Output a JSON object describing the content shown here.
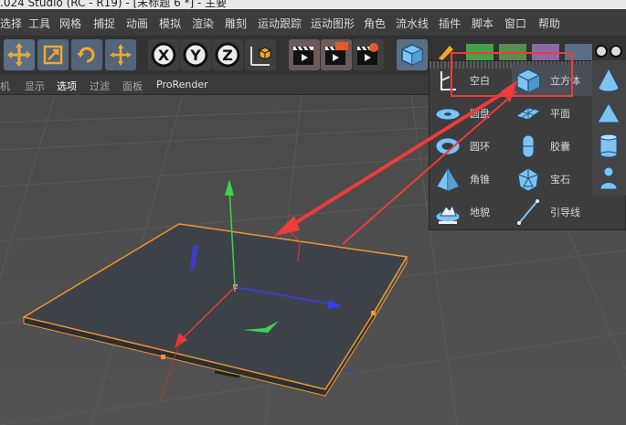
{
  "window": {
    "title": ".024 Studio (RC - R19) - [未标题 6 *] - 主要"
  },
  "menu": [
    "选择",
    "工具",
    "网格",
    "捕捉",
    "动画",
    "模拟",
    "渲染",
    "雕刻",
    "运动跟踪",
    "运动图形",
    "角色",
    "流水线",
    "插件",
    "脚本",
    "窗口",
    "帮助"
  ],
  "viewport_menu": [
    "机",
    "显示",
    "选项",
    "过滤",
    "面板",
    "ProRender"
  ],
  "dropdown": {
    "items": [
      {
        "label": "空白",
        "icon": "null-object-icon"
      },
      {
        "label": "立方体",
        "icon": "cube-icon"
      },
      {
        "label": "圆盘",
        "icon": "disc-icon"
      },
      {
        "label": "平面",
        "icon": "plane-icon"
      },
      {
        "label": "圆环",
        "icon": "torus-icon"
      },
      {
        "label": "胶囊",
        "icon": "capsule-icon"
      },
      {
        "label": "角锥",
        "icon": "pyramid-icon"
      },
      {
        "label": "宝石",
        "icon": "platonic-icon"
      },
      {
        "label": "地貌",
        "icon": "landscape-icon"
      },
      {
        "label": "引导线",
        "icon": "guide-icon"
      }
    ],
    "selected": "立方体"
  },
  "toolbar_icons": [
    "move-icon",
    "scale-icon",
    "rotate-icon",
    "move-axis-icon",
    "x-axis-icon",
    "y-axis-icon",
    "z-axis-icon",
    "coordinate-system-icon",
    "render-view-icon",
    "render-picture-viewer-icon",
    "render-settings-icon",
    "cube-object-icon"
  ],
  "colors": {
    "annotation": "#ef3b3b",
    "selection_outline": "#f0962e",
    "plane": "#3d4249"
  }
}
